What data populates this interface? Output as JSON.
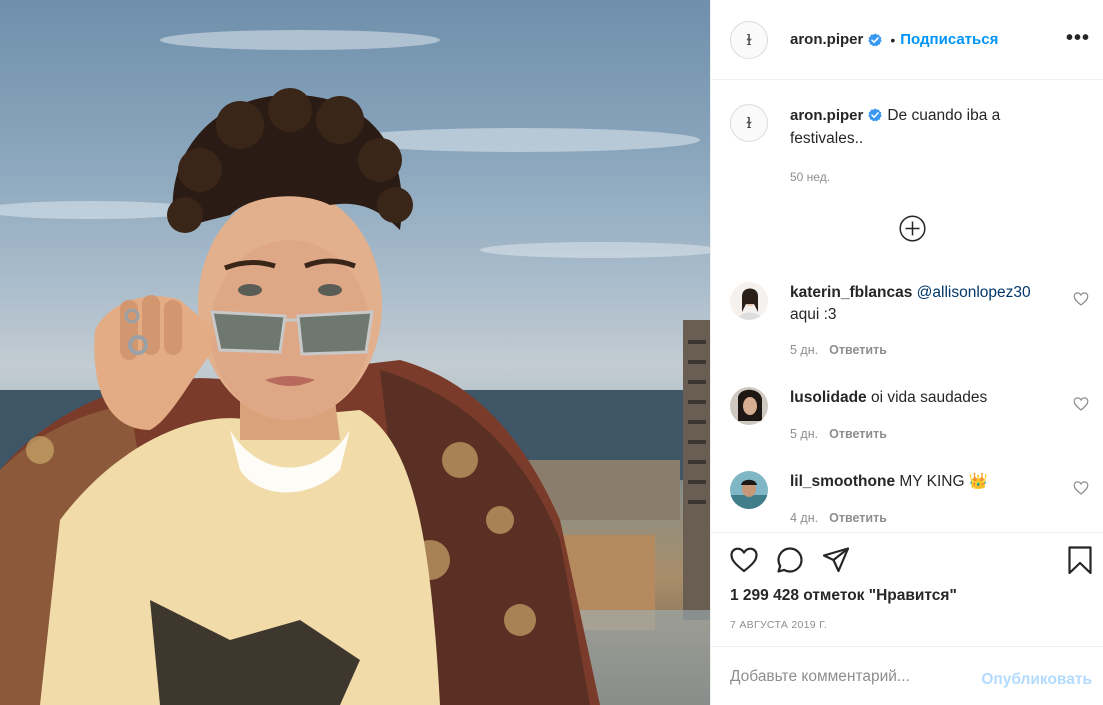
{
  "post": {
    "author": "aron.piper",
    "follow_label": "Подписаться",
    "dot": "•",
    "more_label": "•••",
    "avatar_glyph": "ɫ",
    "caption_text": "De cuando iba a festivales..",
    "caption_time": "50 нед.",
    "likes": "1 299 428 отметок \"Нравится\"",
    "date": "7 АВГУСТА 2019 Г."
  },
  "comments": [
    {
      "user": "katerin_fblancas",
      "mention": "@allisonlopez30",
      "text": " aqui :3",
      "time": "5 дн.",
      "reply": "Ответить"
    },
    {
      "user": "lusolidade",
      "mention": "",
      "text": " oi vida saudades",
      "time": "5 дн.",
      "reply": "Ответить"
    },
    {
      "user": "lil_smoothone",
      "mention": "",
      "text": " MY KING 👑",
      "time": "4 дн.",
      "reply": "Ответить"
    }
  ],
  "add_comment": {
    "placeholder": "Добавьте комментарий...",
    "publish_label": "Опубликовать"
  },
  "icons": {
    "verified": "verified-badge-icon",
    "more": "more-options-icon",
    "load_more": "plus-circle-icon",
    "like": "heart-icon",
    "comment": "comment-bubble-icon",
    "share": "paper-plane-icon",
    "save": "bookmark-icon"
  },
  "colors": {
    "link_blue": "#0095f6",
    "verified_blue": "#3897f0",
    "muted": "#8e8e8e",
    "publish_disabled": "#b3dbff"
  }
}
